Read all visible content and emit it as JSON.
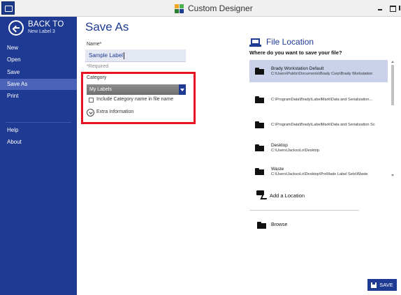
{
  "window": {
    "title": "Custom Designer"
  },
  "sidebar": {
    "back_label": "BACK TO",
    "back_sub": "New Label 3",
    "items": [
      {
        "label": "New"
      },
      {
        "label": "Open"
      },
      {
        "label": "Save"
      },
      {
        "label": "Save As",
        "active": true
      },
      {
        "label": "Print"
      },
      {
        "label": "Help"
      },
      {
        "label": "About"
      }
    ]
  },
  "main": {
    "title": "Save As",
    "name_label": "Name*",
    "name_value": "Sample Label",
    "required_note": "*Required",
    "category_label": "Category",
    "category_value": "My Labels",
    "include_category_label": "Include Category name in file name",
    "extra_info_label": "Extra Information"
  },
  "file_location": {
    "title": "File Location",
    "question": "Where do you want to save your file?",
    "locations": [
      {
        "name": "Brady Workstation Default",
        "path": "C:\\Users\\Public\\Documents\\Brady Corp\\Brady Workstation",
        "selected": true
      },
      {
        "name": "",
        "path": "C:\\ProgramData\\Brady\\LabelMark\\Data and Serialization..."
      },
      {
        "name": "",
        "path": "C:\\ProgramData\\Brady\\LabelMark\\Data and Serialization Sc"
      },
      {
        "name": "Desktop",
        "path": "C:\\Users\\JacksoLo\\Desktop"
      },
      {
        "name": "Waste",
        "path": "C:\\Users\\JacksoLo\\Desktop\\PreMade Label Sets\\Waste"
      }
    ],
    "add_location_label": "Add a Location",
    "browse_label": "Browse"
  },
  "actions": {
    "save_label": "SAVE"
  },
  "colors": {
    "accent": "#1f3a93",
    "highlight": "#e81123",
    "selected": "#c9d2ea"
  }
}
